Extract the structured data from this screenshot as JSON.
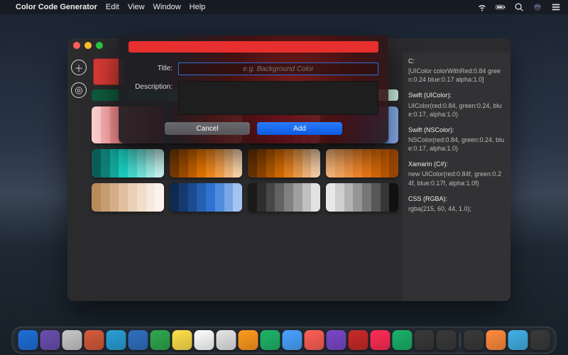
{
  "menubar": {
    "app": "Color Code Generator",
    "items": [
      "Edit",
      "View",
      "Window",
      "Help"
    ]
  },
  "window": {
    "current_color": "#d63a34"
  },
  "palettes": {
    "single": [
      "#0e5a3c",
      "#12744c",
      "#16a36b",
      "#1cc786",
      "#48d6a0",
      "#7ce2bb",
      "#a9edd2",
      "#d0f6e6"
    ],
    "rows": [
      [
        [
          "#ffcfcf",
          "#ffb1b1",
          "#ff9393",
          "#ff7575",
          "#f85757",
          "#eb3b3b",
          "#d62828",
          "#b51717"
        ],
        [
          "#5a0f0f",
          "#7a1515",
          "#9a1b1b",
          "#b82020",
          "#d62828",
          "#e24545",
          "#ec6b6b",
          "#f49898"
        ],
        [
          "#5c073a",
          "#7a0a4c",
          "#9a0d60",
          "#b81073",
          "#d11685",
          "#e24099",
          "#ec6db1",
          "#f59bca"
        ],
        [
          "#041a3a",
          "#06275a",
          "#083680",
          "#0b46a6",
          "#0f58cc",
          "#2f72da",
          "#5a90e6",
          "#8bb1f0"
        ]
      ],
      [
        [
          "#0a5e57",
          "#0e8178",
          "#13a99d",
          "#1ccfc1",
          "#45dbd0",
          "#74e6dd",
          "#a2efe9",
          "#c9f6f2"
        ],
        [
          "#7a3b00",
          "#a04e00",
          "#c56200",
          "#e67600",
          "#f58a1f",
          "#f7a34d",
          "#f9bd7e",
          "#fcd7af"
        ],
        [
          "#6b3400",
          "#8f4600",
          "#b35900",
          "#d66c00",
          "#e88320",
          "#ef9d4d",
          "#f4b77c",
          "#f9d2ab"
        ],
        [
          "#fbb87a",
          "#f9a85f",
          "#f79845",
          "#f4882c",
          "#e77818",
          "#d36809",
          "#b95700",
          "#9c4700"
        ]
      ],
      [
        [
          "#b98b5a",
          "#c79c70",
          "#d4ae88",
          "#e0c0a1",
          "#e9d0b7",
          "#f0ddca",
          "#f6e9dd",
          "#fbf3ec"
        ],
        [
          "#0f2a50",
          "#153a6e",
          "#1c4c8e",
          "#245fb0",
          "#2e73d0",
          "#4f8cdc",
          "#78a7e6",
          "#a4c3f0"
        ],
        [
          "#1a1a1a",
          "#2e2e2e",
          "#474747",
          "#626262",
          "#808080",
          "#9f9f9f",
          "#c0c0c0",
          "#e2e2e2"
        ],
        [
          "#e8e8e8",
          "#cfcfcf",
          "#b3b3b3",
          "#969696",
          "#777777",
          "#575757",
          "#363636",
          "#111111"
        ]
      ]
    ]
  },
  "code": {
    "groups": [
      {
        "label": "C:",
        "value": "[UIColor colorWithRed:0.84 green:0.24 blue:0.17 alpha:1.0]"
      },
      {
        "label": "Swift (UIColor):",
        "value": "UIColor(red:0.84, green:0.24, blue:0.17, alpha:1.0)"
      },
      {
        "label": "Swift (NSColor):",
        "value": "NSColor(red:0.84, green:0.24, blue:0.17, alpha:1.0)"
      },
      {
        "label": "Xamarin (C#):",
        "value": "new UIColor(red:0.84f, green:0.24f, blue:0.17f, alpha:1.0f)"
      },
      {
        "label": "CSS (RGBA):",
        "value": "rgba(215, 60, 44, 1.0);"
      }
    ]
  },
  "sheet": {
    "title_label": "Title:",
    "title_placeholder": "e.g. Background Color",
    "desc_label": "Description:",
    "cancel": "Cancel",
    "add": "Add"
  },
  "dock": {
    "apps": [
      "#1e6fd8",
      "#6a4fb0",
      "#c8c8c8",
      "#d65a3a",
      "#2a9fd6",
      "#3070c0",
      "#2fa84f",
      "#ffe14a",
      "#ffffff",
      "#e6e6e6",
      "#ff9a1f",
      "#1fb56a",
      "#4aa3ff",
      "#ff5f57",
      "#7a48c8",
      "#c92a2a",
      "#ff2d55",
      "#1ab26b",
      "#3a3a3a",
      "#3a3a3a",
      "#3a3a3a",
      "#ff8a3d",
      "#43b0e6",
      "#3a3a3a"
    ]
  }
}
